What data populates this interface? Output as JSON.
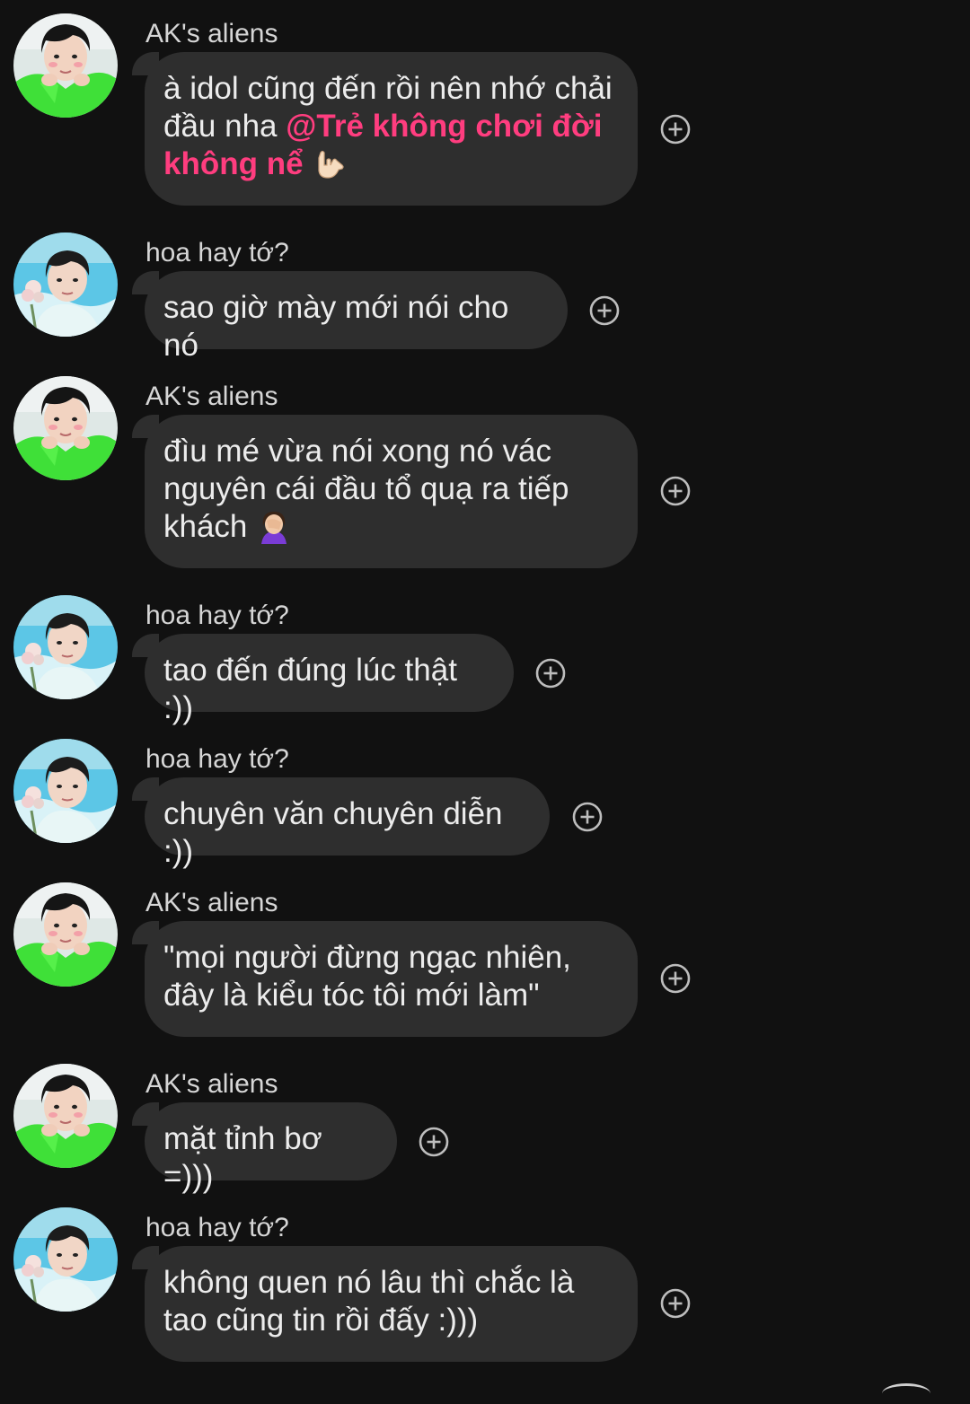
{
  "messages": [
    {
      "sender": "AK's aliens",
      "avatar": "green-shirt-avatar",
      "text_lines": [
        "à idol cũng đến rồi nên nhớ chải",
        "đầu nha "
      ],
      "mention_part1": "@Trẻ không chơi đời",
      "mention_part2": "không nể",
      "emoji": "love-you-gesture-emoji"
    },
    {
      "sender": "hoa hay tớ?",
      "avatar": "pool-boy-avatar",
      "text": "sao giờ mày mới nói cho nó"
    },
    {
      "sender": "AK's aliens",
      "avatar": "green-shirt-avatar",
      "text_lines": [
        "đìu mé vừa nói xong nó vác",
        "nguyên cái đầu tổ quạ ra tiếp",
        "khách "
      ],
      "emoji": "facepalm-emoji"
    },
    {
      "sender": "hoa hay tớ?",
      "avatar": "pool-boy-avatar",
      "text": "tao đến đúng lúc thật :))"
    },
    {
      "sender": "hoa hay tớ?",
      "avatar": "pool-boy-avatar",
      "text": "chuyên văn chuyên diễn :))"
    },
    {
      "sender": "AK's aliens",
      "avatar": "green-shirt-avatar",
      "text_lines": [
        "\"mọi người đừng ngạc nhiên,",
        "đây là kiểu tóc tôi mới làm\""
      ]
    },
    {
      "sender": "AK's aliens",
      "avatar": "green-shirt-avatar",
      "text": "mặt tỉnh bơ =)))"
    },
    {
      "sender": "hoa hay tớ?",
      "avatar": "pool-boy-avatar",
      "text_lines": [
        "không quen nó lâu thì chắc là",
        "tao cũng tin rồi đấy :)))"
      ]
    }
  ],
  "reaction_icon": "add-reaction-icon",
  "colors": {
    "background": "#111111",
    "bubble": "#2e2e2e",
    "text": "#ececec",
    "sender": "#d6d6d6",
    "mention": "#ff3d7f",
    "icon": "#bdbdbd"
  }
}
